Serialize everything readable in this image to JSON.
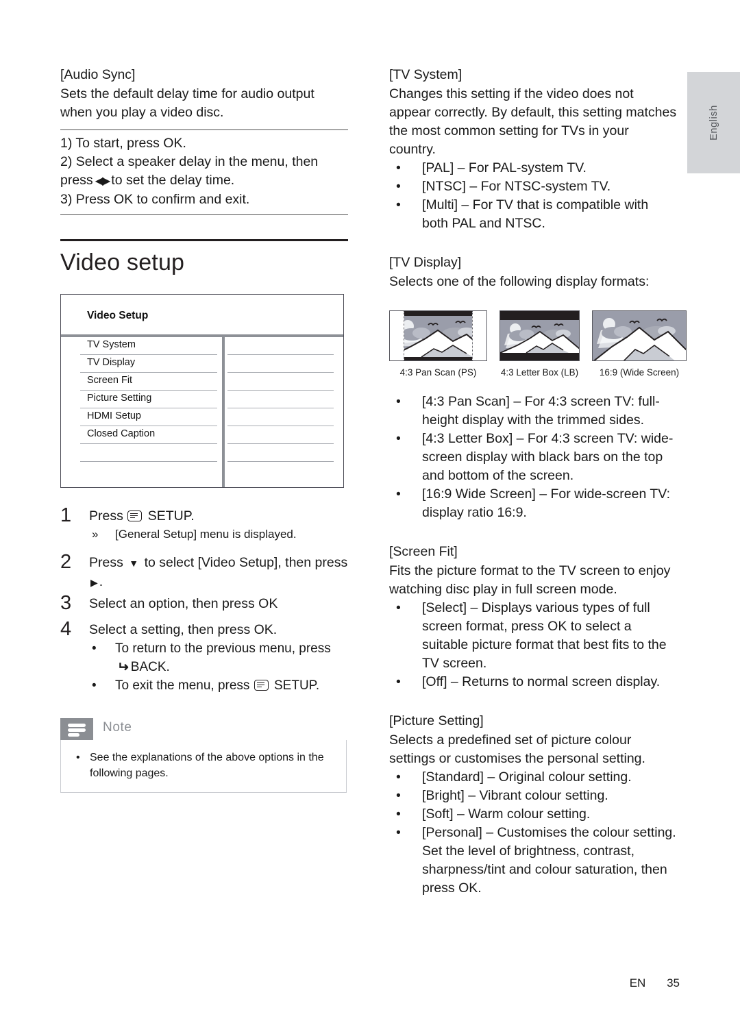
{
  "language_tab": {
    "label": "English"
  },
  "footer": {
    "lang_code": "EN",
    "page_number": "35"
  },
  "left_column": {
    "audio_sync": {
      "heading": "[Audio Sync]",
      "body": "Sets the default delay time for audio output when you play a video disc.",
      "procedure": [
        "1) To start, press OK.",
        "2) Select a speaker delay in the menu, then press ◀▶ to set the delay time.",
        "3) Press OK to confirm and exit."
      ],
      "procedure_parts": {
        "step1": "1) To start, press OK.",
        "step2a": "2) Select a speaker delay in the menu, then",
        "step2b_pre": "press",
        "step2b_post": "to set the delay time.",
        "step3": "3) Press OK to confirm and exit."
      }
    },
    "section_title": "Video setup",
    "menu": {
      "title": "Video Setup",
      "rows": [
        {
          "label": "TV System"
        },
        {
          "label": "TV Display"
        },
        {
          "label": "Screen Fit"
        },
        {
          "label": "Picture Setting"
        },
        {
          "label": "HDMI Setup"
        },
        {
          "label": "Closed Caption"
        },
        {
          "label": ""
        },
        {
          "label": ""
        }
      ]
    },
    "steps": [
      {
        "number": "1",
        "text_pre": "Press",
        "text_post": "SETUP.",
        "icon": "setup-icon",
        "sub": [
          {
            "marker": "»",
            "text": "[General Setup] menu is displayed."
          }
        ]
      },
      {
        "number": "2",
        "text_pre": "Press",
        "text_mid": "to select [Video Setup], then press",
        "text_post": ".",
        "icon_down": "▼",
        "icon_right": "▶",
        "sub": []
      },
      {
        "number": "3",
        "text_full": "Select an option, then press OK",
        "sub": []
      },
      {
        "number": "4",
        "text_full": "Select a setting, then press OK.",
        "sub": [
          {
            "marker": "•",
            "text_pre": "To return to the previous menu, press",
            "text_post": "BACK.",
            "icon": "back-icon"
          },
          {
            "marker": "•",
            "text_pre": "To exit the menu, press",
            "text_post": "SETUP.",
            "icon": "setup-icon"
          }
        ]
      }
    ],
    "note": {
      "tab_label": "Note",
      "icon": "note-lines-icon",
      "items": [
        {
          "marker": "•",
          "text": "See the explanations of the above options in the following pages."
        }
      ]
    }
  },
  "right_column": {
    "tv_system": {
      "heading": "[TV System]",
      "body": "Changes this setting if the video does not appear correctly. By default, this setting matches the most common setting for TVs in your country.",
      "bullets": [
        "[PAL] – For PAL-system TV.",
        "[NTSC] – For NTSC-system TV.",
        "[Multi] – For TV that is compatible with both PAL and NTSC."
      ]
    },
    "tv_display": {
      "heading": "[TV Display]",
      "body": "Selects one of the following display formats:",
      "figures": [
        {
          "caption": "4:3 Pan Scan (PS)",
          "type": "pan-scan"
        },
        {
          "caption": "4:3 Letter Box (LB)",
          "type": "letter-box"
        },
        {
          "caption": "16:9 (Wide Screen)",
          "type": "wide-screen"
        }
      ],
      "bullets": [
        "[4:3 Pan Scan] – For 4:3 screen TV: full-height display with the trimmed sides.",
        "[4:3 Letter Box] – For 4:3 screen TV: wide-screen display with black bars on the top and bottom of the screen.",
        "[16:9 Wide Screen] – For wide-screen TV: display ratio 16:9."
      ]
    },
    "screen_fit": {
      "heading": "[Screen Fit]",
      "body": "Fits the picture format to the TV screen to enjoy watching disc play in full screen mode.",
      "bullets": [
        "[Select] – Displays various types of full screen format, press OK to select a suitable picture format that best fits to the TV screen.",
        "[Off] – Returns to normal screen display."
      ]
    },
    "picture_setting": {
      "heading": "[Picture Setting]",
      "body": "Selects a predefined set of picture colour settings or customises the personal setting.",
      "bullets": [
        "[Standard] – Original colour setting.",
        "[Bright] – Vibrant colour setting.",
        "[Soft] – Warm colour setting.",
        "[Personal] – Customises the colour setting. Set the level of brightness, contrast, sharpness/tint and colour saturation, then press OK."
      ]
    }
  },
  "colors": {
    "tab_gray": "#d3d5d8",
    "note_gray": "#8b8e93",
    "table_line": "#8d9096",
    "text": "#1a1a1a",
    "sky": "#9a9daa"
  }
}
